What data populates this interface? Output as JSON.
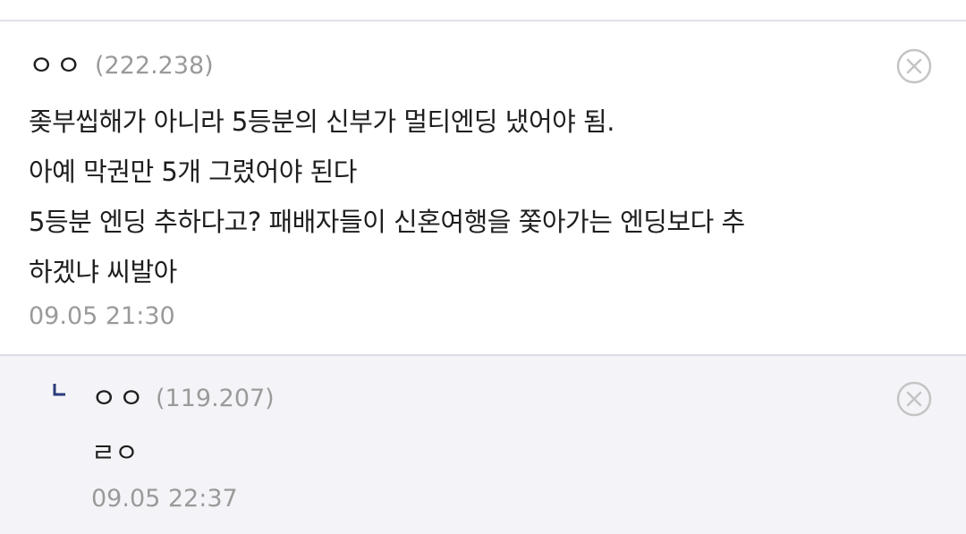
{
  "comments": [
    {
      "nickname": "ㅇㅇ",
      "ip": "(222.238)",
      "lines": [
        "좆부씹해가 아니라 5등분의 신부가 멀티엔딩 냈어야 됨.",
        "아예 막권만 5개 그렸어야 된다",
        "5등분 엔딩 추하다고? 패배자들이 신혼여행을 쫓아가는 엔딩보다 추",
        "하겠냐 씨발아"
      ],
      "timestamp": "09.05 21:30",
      "delete_icon": "close-circle-icon"
    },
    {
      "reply_icon": "reply-arrow-icon",
      "nickname": "ㅇㅇ",
      "ip": "(119.207)",
      "lines": [
        "ㄹㅇ"
      ],
      "timestamp": "09.05 22:37",
      "delete_icon": "close-circle-icon"
    }
  ],
  "colors": {
    "reply_background": "#f4f4f8",
    "muted_text": "#9a9a9a",
    "text": "#1e1e1e",
    "divider": "#dcdce6"
  }
}
